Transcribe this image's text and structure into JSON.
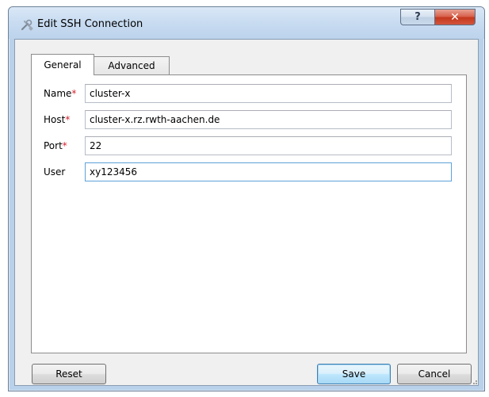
{
  "window": {
    "title": "Edit SSH Connection",
    "help_label": "?",
    "close_label": "✕"
  },
  "tabs": [
    {
      "label": "General",
      "active": true
    },
    {
      "label": "Advanced",
      "active": false
    }
  ],
  "form": {
    "required_marker": "*",
    "fields": [
      {
        "label": "Name",
        "required": true,
        "value": "cluster-x"
      },
      {
        "label": "Host",
        "required": true,
        "value": "cluster-x.rz.rwth-aachen.de"
      },
      {
        "label": "Port",
        "required": true,
        "value": "22"
      },
      {
        "label": "User",
        "required": false,
        "value": "xy123456"
      }
    ]
  },
  "buttons": {
    "reset": "Reset",
    "save": "Save",
    "cancel": "Cancel"
  },
  "colors": {
    "required": "#d4202c",
    "focus_border": "#5da2d9",
    "close_button": "#c4371d"
  }
}
